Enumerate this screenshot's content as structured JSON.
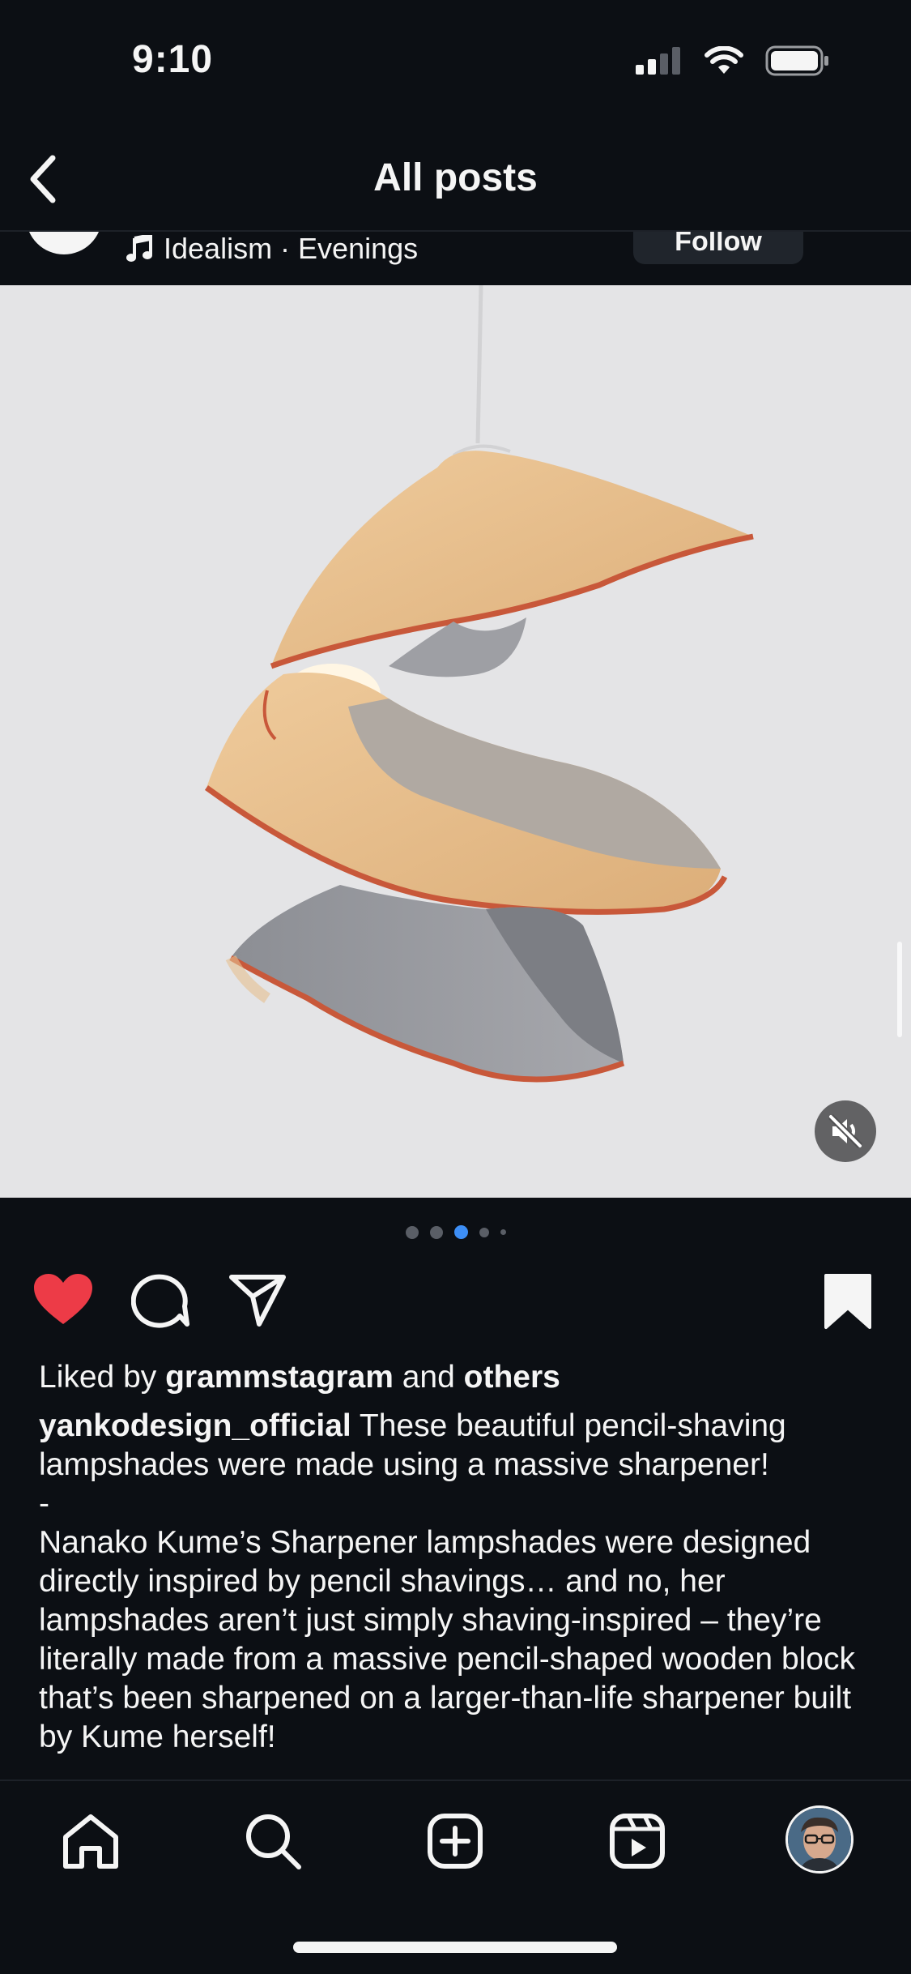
{
  "status": {
    "time": "9:10"
  },
  "header": {
    "title": "All posts"
  },
  "post": {
    "audio": "Idealism · Evenings",
    "follow_label": "Follow",
    "carousel": {
      "count": 5,
      "active_index": 3
    },
    "liked_by_prefix": "Liked by",
    "liked_by_user": "grammstagram",
    "liked_by_and": "and",
    "liked_by_others": "others",
    "author": "yankodesign_official",
    "caption_lines": [
      "These beautiful pencil-shaving lampshades were made using a massive sharpener!",
      "-",
      "Nanako Kume’s Sharpener lampshades were designed directly inspired by pencil shavings… and no, her lampshades aren’t just simply shaving-inspired – they’re literally made from a massive pencil-shaped wooden block that’s been sharpened on a larger-than-life sharpener built by Kume herself!"
    ]
  },
  "icons": {
    "back": "chevron-left-icon",
    "music": "music-note-icon",
    "mute": "speaker-muted-icon",
    "like": "heart-filled-icon",
    "comment": "speech-bubble-icon",
    "share": "paper-plane-icon",
    "save": "bookmark-filled-icon",
    "nav": [
      "home-icon",
      "search-icon",
      "create-plus-icon",
      "reels-icon",
      "profile-avatar"
    ]
  },
  "colors": {
    "background": "#0c0f14",
    "like_red": "#ed3b47",
    "active_dot": "#3d8ef5",
    "text": "#f5f5f5"
  }
}
